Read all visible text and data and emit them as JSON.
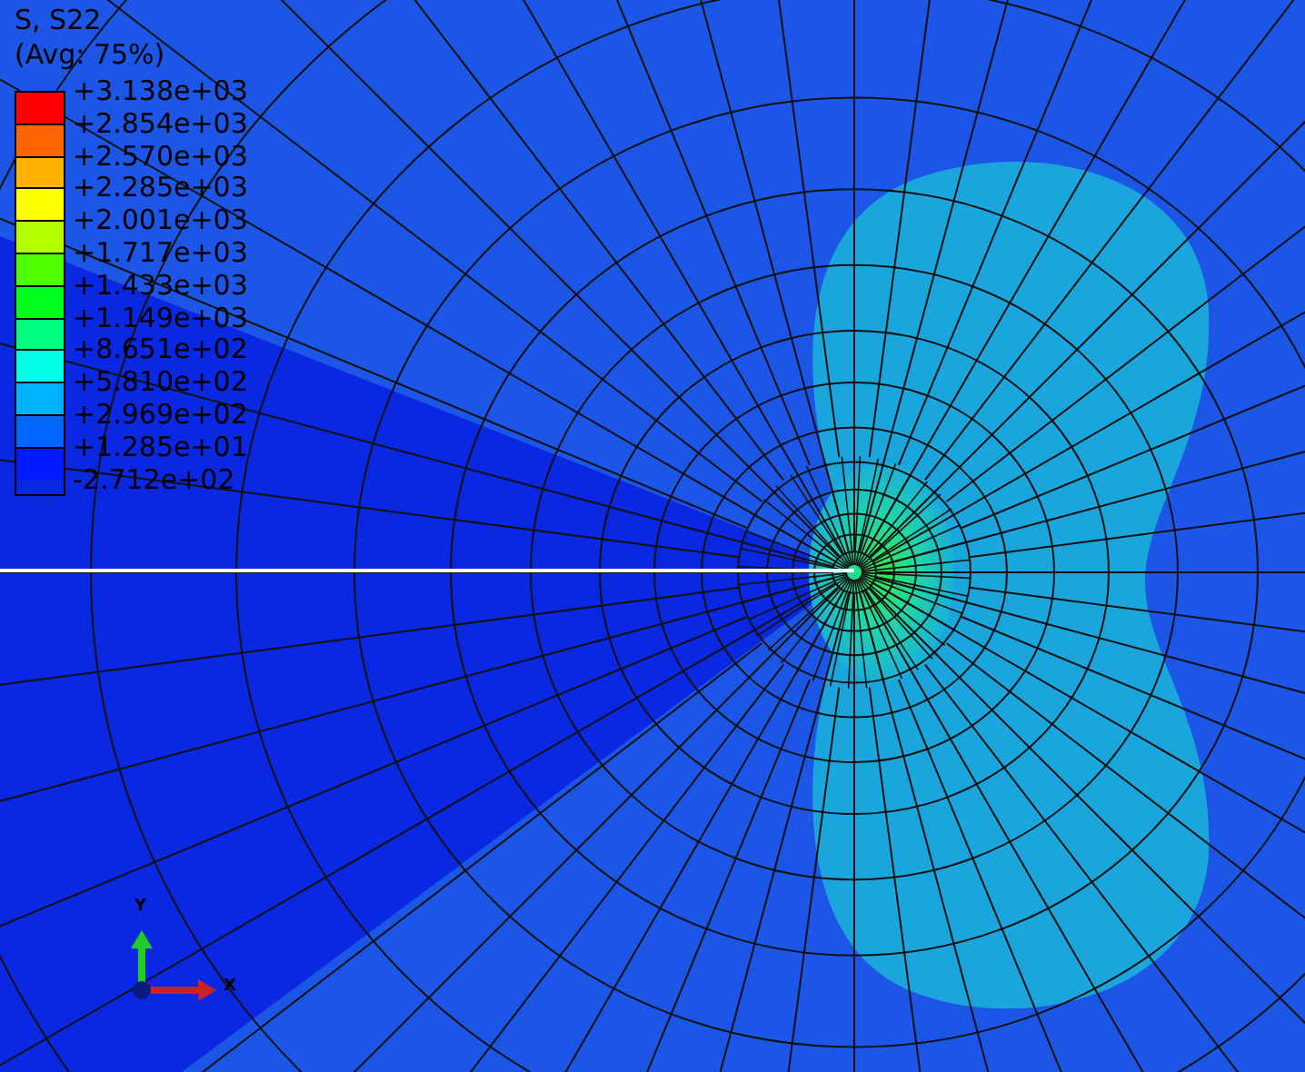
{
  "legend": {
    "title": "S, S22",
    "subtitle": "(Avg: 75%)",
    "bands": [
      {
        "color": "#ff0000"
      },
      {
        "color": "#ff6600"
      },
      {
        "color": "#ffb300"
      },
      {
        "color": "#ffff00"
      },
      {
        "color": "#b3ff00"
      },
      {
        "color": "#4dff00"
      },
      {
        "color": "#00ff1a"
      },
      {
        "color": "#00ff80"
      },
      {
        "color": "#00ffe6"
      },
      {
        "color": "#00b3ff"
      },
      {
        "color": "#0066ff"
      },
      {
        "color": "#0019ff"
      }
    ],
    "ticks": [
      "+3.138e+03",
      "+2.854e+03",
      "+2.570e+03",
      "+2.285e+03",
      "+2.001e+03",
      "+1.717e+03",
      "+1.433e+03",
      "+1.149e+03",
      "+8.651e+02",
      "+5.810e+02",
      "+2.969e+02",
      "+1.285e+01",
      "-2.712e+02"
    ]
  },
  "triad": {
    "y_label": "Y",
    "x_label": "X"
  }
}
